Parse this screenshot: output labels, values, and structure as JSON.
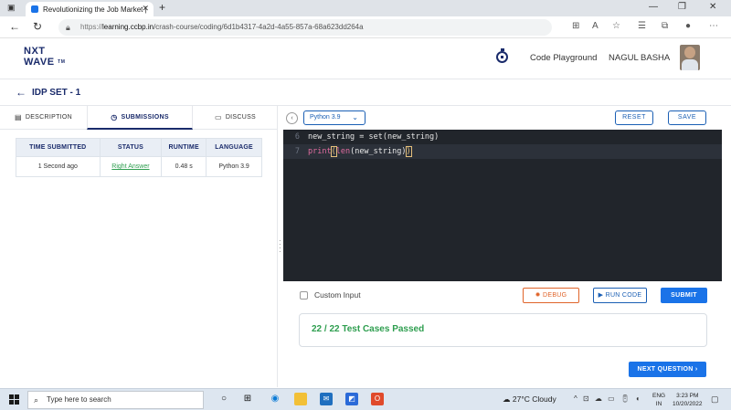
{
  "browser": {
    "tab_title": "Revolutionizing the Job Market |",
    "url_host": "learning.ccbp.in",
    "url_path": "/crash-course/coding/6d1b4317-4a2d-4a55-857a-68a623dd264a"
  },
  "header": {
    "logo_line1": "NXT",
    "logo_line2": "WAVE",
    "logo_tm": "TM",
    "code_playground": "Code Playground",
    "user_name": "NAGUL BASHA"
  },
  "page": {
    "title": "IDP SET - 1"
  },
  "left_tabs": [
    {
      "label": "DESCRIPTION",
      "icon": "description-icon"
    },
    {
      "label": "SUBMISSIONS",
      "icon": "clock-icon"
    },
    {
      "label": "DISCUSS",
      "icon": "chat-icon"
    }
  ],
  "submissions": {
    "headers": [
      "TIME SUBMITTED",
      "STATUS",
      "RUNTIME",
      "LANGUAGE"
    ],
    "rows": [
      {
        "time": "1 Second ago",
        "status": "Right Answer",
        "runtime": "0.48 s",
        "language": "Python 3.9"
      }
    ]
  },
  "editor_toolbar": {
    "language": "Python 3.9",
    "reset_label": "RESET",
    "save_label": "SAVE"
  },
  "editor": {
    "lines": [
      {
        "num": "6",
        "text": "new_string = set(new_string)"
      },
      {
        "num": "7",
        "fn1": "print",
        "p1": "(",
        "fn2": "len",
        "rest": "(new_string)",
        "p2": ")"
      }
    ]
  },
  "actions": {
    "custom_input": "Custom Input",
    "debug": "DEBUG",
    "run_code": "RUN CODE",
    "submit": "SUBMIT",
    "result": "22 / 22 Test Cases Passed",
    "next_question": "NEXT QUESTION"
  },
  "taskbar": {
    "search_placeholder": "Type here to search",
    "weather": "27°C  Cloudy",
    "lang1": "ENG",
    "lang2": "IN",
    "time": "3:23 PM",
    "date": "10/20/2022"
  },
  "colors": {
    "brand": "#1a2b6b",
    "primary": "#1a73e8",
    "success": "#2e9e4f",
    "debug": "#e0642a",
    "editor_bg": "#21252b"
  }
}
